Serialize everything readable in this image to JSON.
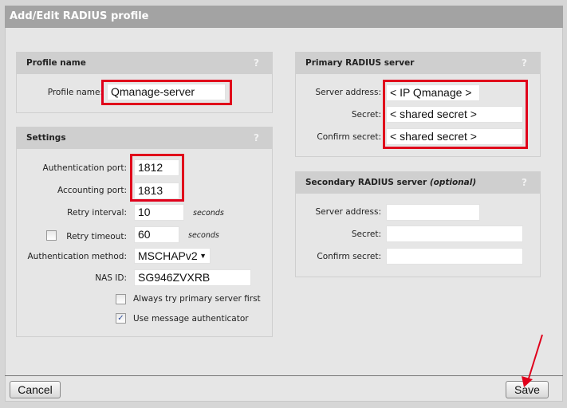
{
  "title": "Add/Edit RADIUS profile",
  "profile": {
    "header": "Profile name",
    "help": "?",
    "label": "Profile name:",
    "value": "Qmanage-server"
  },
  "settings": {
    "header": "Settings",
    "help": "?",
    "auth_port_label": "Authentication port:",
    "auth_port": "1812",
    "acct_port_label": "Accounting port:",
    "acct_port": "1813",
    "retry_interval_label": "Retry interval:",
    "retry_interval": "10",
    "retry_interval_unit": "seconds",
    "retry_timeout_label": "Retry timeout:",
    "retry_timeout": "60",
    "retry_timeout_unit": "seconds",
    "retry_timeout_checked": false,
    "auth_method_label": "Authentication method:",
    "auth_method": "MSCHAPv2",
    "nas_id_label": "NAS ID:",
    "nas_id": "SG946ZVXRB",
    "always_primary_label": "Always try primary server first",
    "always_primary_checked": false,
    "msg_auth_label": "Use message authenticator",
    "msg_auth_checked": true
  },
  "primary": {
    "header": "Primary RADIUS server",
    "help": "?",
    "address_label": "Server address:",
    "address": "< IP Qmanage >",
    "secret_label": "Secret:",
    "secret": "< shared secret >",
    "confirm_label": "Confirm secret:",
    "confirm": "< shared secret >"
  },
  "secondary": {
    "header": "Secondary RADIUS server",
    "header_suffix": "(optional)",
    "help": "?",
    "address_label": "Server address:",
    "address": "",
    "secret_label": "Secret:",
    "secret": "",
    "confirm_label": "Confirm secret:",
    "confirm": ""
  },
  "buttons": {
    "cancel": "Cancel",
    "save": "Save"
  },
  "colors": {
    "highlight": "#e0001b",
    "title_bar": "#a3a3a3"
  }
}
